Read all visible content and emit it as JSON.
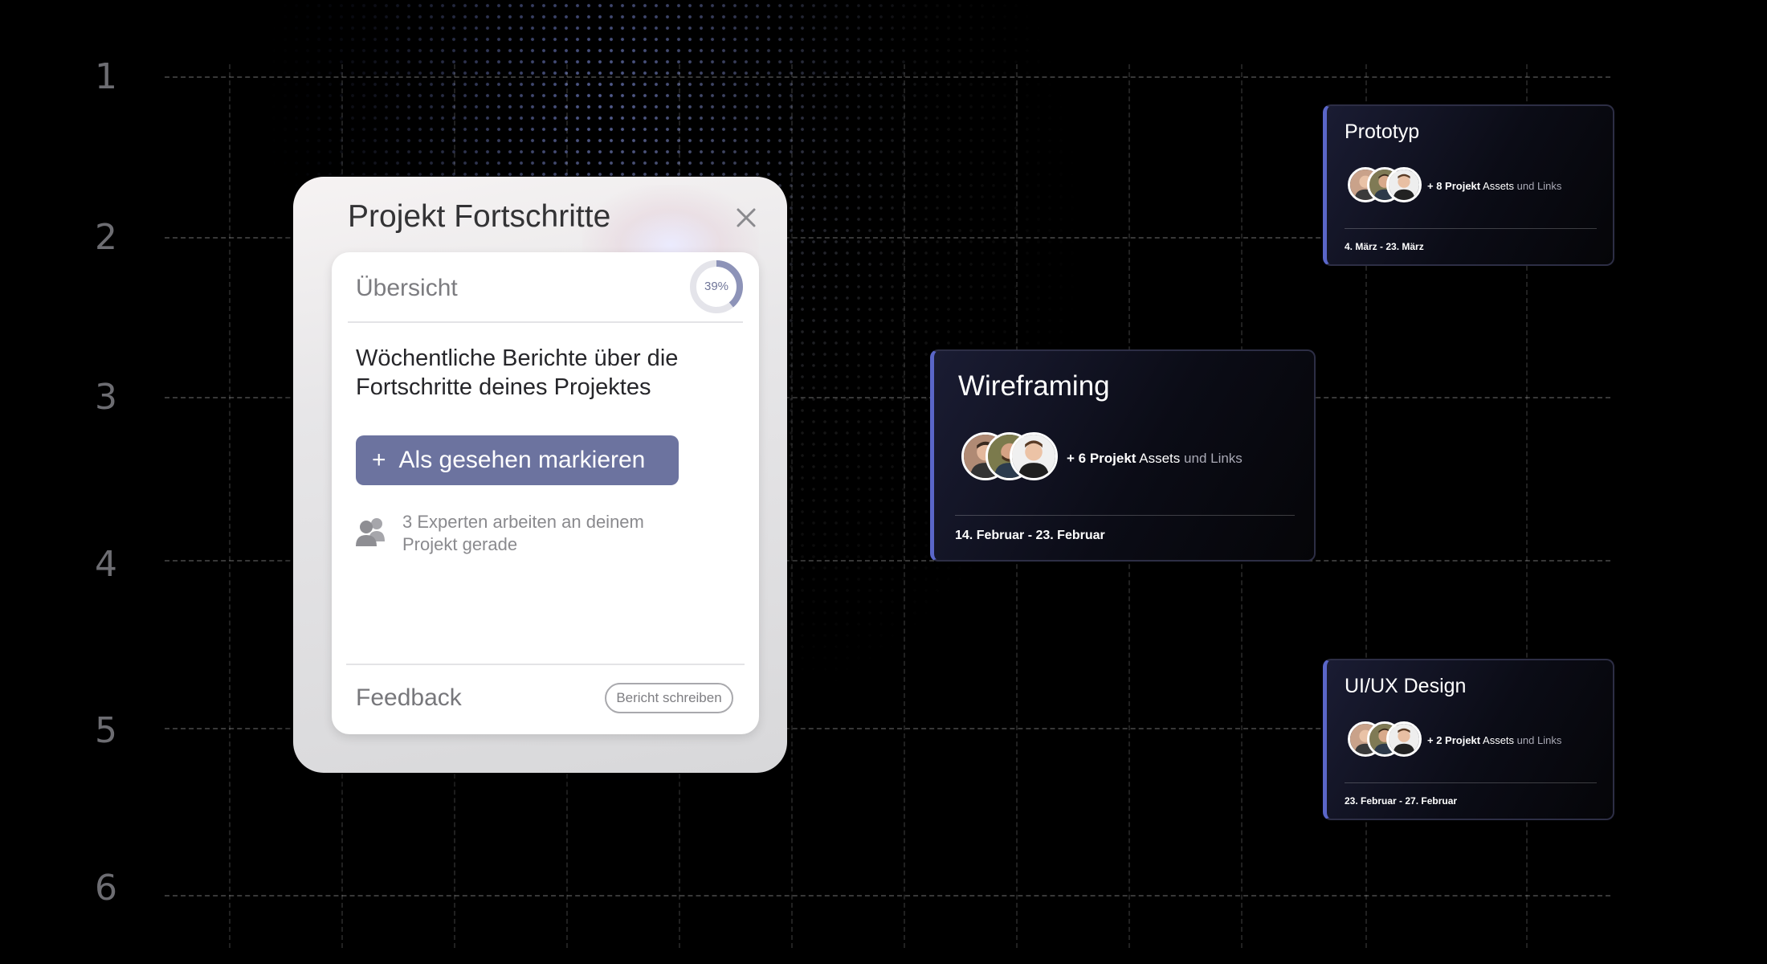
{
  "grid": {
    "row_numbers": [
      "1",
      "2",
      "3",
      "4",
      "5",
      "6"
    ]
  },
  "panel": {
    "title": "Projekt Fortschritte",
    "close_icon": "close-icon",
    "tab_label": "Übersicht",
    "progress_percent": 39,
    "progress_label": "39%",
    "description": "Wöchentliche Berichte über die Fortschritte deines Projektes",
    "mark_button_plus": "+",
    "mark_button_label": "Als gesehen markieren",
    "experts_icon": "users-icon",
    "experts_text": "3 Experten arbeiten an deinem Projekt gerade",
    "feedback_label": "Feedback",
    "report_button_label": "Bericht schreiben",
    "accent_color": "#6c739f"
  },
  "cards": {
    "prototyp": {
      "title": "Prototyp",
      "assets_prefix": "+ 8 Projekt",
      "assets_mid": "Assets",
      "assets_suffix": "und Links",
      "date": "4. März - 23. März"
    },
    "wireframing": {
      "title": "Wireframing",
      "assets_prefix": "+ 6 Projekt",
      "assets_mid": "Assets",
      "assets_suffix": "und Links",
      "date": "14. Februar - 23. Februar"
    },
    "uiux": {
      "title": "UI/UX Design",
      "assets_prefix": "+ 2 Projekt",
      "assets_mid": "Assets",
      "assets_suffix": "und Links",
      "date": "23. Februar - 27. Februar"
    },
    "accent_color": "#5a66c8"
  }
}
